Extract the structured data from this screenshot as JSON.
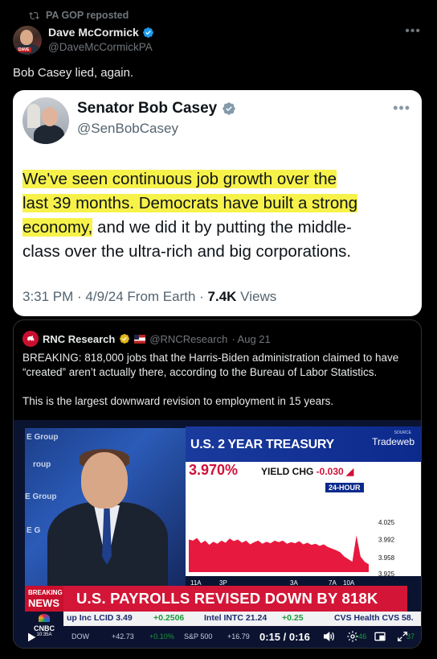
{
  "repost": {
    "label": "PA GOP reposted"
  },
  "author": {
    "name": "Dave McCormick",
    "handle": "@DaveMcCormickPA",
    "avatar_tag": "DAVE"
  },
  "tweet": {
    "text": "Bob Casey lied, again."
  },
  "embedded": {
    "name": "Senator Bob Casey",
    "handle": "@SenBobCasey",
    "body_highlight_1": "We've seen continuous job growth over the",
    "body_highlight_2": "last 39 months. Democrats have built a strong",
    "body_highlight_3": "economy,",
    "body_rest_1": " and we did it by putting the middle-",
    "body_rest_2": "class over the ultra-rich and big corporations.",
    "meta_time": "3:31 PM · 4/9/24 From Earth · ",
    "meta_views_count": "7.4K",
    "meta_views_label": " Views"
  },
  "quoted": {
    "name": "RNC Research",
    "handle": "@RNCResearch",
    "date": "· Aug 21",
    "paragraph_1": "BREAKING: 818,000 jobs that the Harris-Biden administration claimed to have “created” aren’t actually there, according to the Bureau of Labor Statistics.",
    "paragraph_2": "This is the largest downward revision to employment in 15 years."
  },
  "video": {
    "studio_signs": [
      "E Group",
      "roup",
      "E Group",
      "E G"
    ],
    "panel_title": "U.S. 2 YEAR TREASURY",
    "source_small": "SOURCE",
    "source_brand": "Tradeweb",
    "price": "3.970%",
    "yield_chg_label": "YIELD CHG ",
    "yield_chg_value": "-0.030",
    "badge": "24-HOUR",
    "breaking_1": "BREAKING",
    "breaking_2": "NEWS",
    "headline": "U.S. PAYROLLS REVISED DOWN BY 818K",
    "ticker_top": [
      "up Inc LCID 3.49",
      "+0.2506",
      "Intel INTC 21.24",
      "+0.25",
      "CVS Health CVS 58."
    ],
    "ticker_bottom": [
      "DOW",
      "+42.73",
      "+0.10%",
      "S&P 500",
      "+16.79",
      "+46",
      "37"
    ],
    "network": "CNBC",
    "network_time": "10:35A",
    "time_display": "0:15 / 0:16",
    "colors": {
      "red": "#d31637",
      "navy": "#0c2a8c",
      "green": "#1a9b3a"
    }
  },
  "chart_data": {
    "type": "area",
    "title": "U.S. 2 YEAR TREASURY",
    "x_tick_labels": [
      "11A",
      "3P",
      "3A",
      "7A",
      "10A"
    ],
    "y_tick_labels": [
      "4.025",
      "3.992",
      "3.958",
      "3.925"
    ],
    "ylim": [
      3.9,
      4.04
    ],
    "series": [
      {
        "values": [
          3.992,
          3.99,
          3.995,
          3.985,
          3.99,
          3.982,
          3.988,
          3.984,
          3.99,
          3.986,
          3.994,
          3.989,
          3.992,
          3.986,
          3.99,
          3.983,
          3.987,
          3.99,
          3.984,
          3.988,
          3.985,
          3.99,
          3.987,
          3.99,
          3.984,
          3.987,
          3.985,
          3.989,
          3.983,
          3.986,
          3.982,
          3.984,
          3.98,
          3.983,
          3.978,
          3.975,
          3.972,
          3.968,
          3.96,
          3.955,
          3.95,
          4.0,
          3.96,
          3.95,
          3.945
        ]
      }
    ]
  }
}
